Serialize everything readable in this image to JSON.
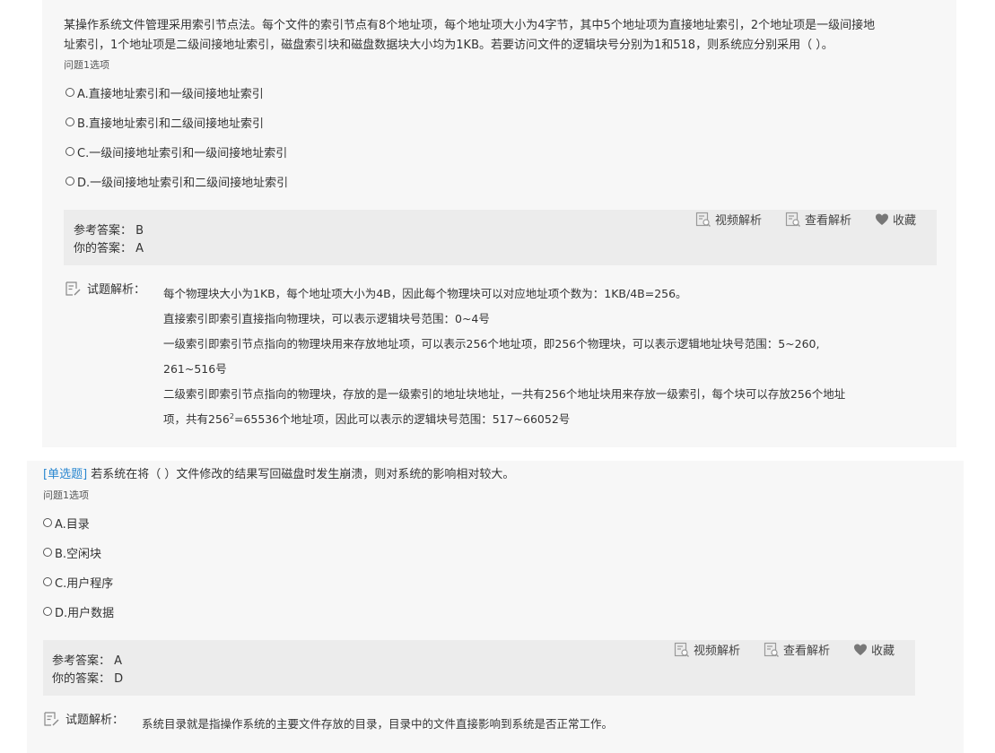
{
  "question1": {
    "text_line1": "某操作系统文件管理采用索引节点法。每个文件的索引节点有8个地址项，每个地址项大小为4字节，其中5个地址项为直接地址索引，2个地址项是一级间接地",
    "text_line2": "址索引，1个地址项是二级间接地址索引，磁盘索引块和磁盘数据块大小均为1KB。若要访问文件的逻辑块号分别为1和518，则系统应分别采用（ ）。",
    "subtitle": "问题1选项",
    "options": [
      {
        "label": "A.直接地址索引和一级间接地址索引"
      },
      {
        "label": "B.直接地址索引和二级间接地址索引"
      },
      {
        "label": "C.一级间接地址索引和一级间接地址索引"
      },
      {
        "label": "D.一级间接地址索引和二级间接地址索引"
      }
    ],
    "reference_answer_label": "参考答案：",
    "reference_answer": "B",
    "your_answer_label": "你的答案：",
    "your_answer": "A",
    "explanation_label": "试题解析：",
    "explanation": {
      "line1": "每个物理块大小为1KB，每个地址项大小为4B，因此每个物理块可以对应地址项个数为：1KB/4B=256。",
      "line2": "直接索引即索引直接指向物理块，可以表示逻辑块号范围：0~4号",
      "line3": "一级索引即索引节点指向的物理块用来存放地址项，可以表示256个地址项，即256个物理块，可以表示逻辑地址块号范围：5~260,",
      "line4": "261~516号",
      "line5": "二级索引即索引节点指向的物理块，存放的是一级索引的地址块地址，一共有256个地址块用来存放一级索引，每个块可以存放256个地址",
      "line6_a": "项，共有256",
      "line6_sup": "2",
      "line6_b": "=65536个地址项，因此可以表示的逻辑块号范围：517~66052号"
    }
  },
  "question2": {
    "type_tag": "[单选题]",
    "text": "若系统在将（ ）文件修改的结果写回磁盘时发生崩溃，则对系统的影响相对较大。",
    "subtitle": "问题1选项",
    "options": [
      {
        "label": "A.目录"
      },
      {
        "label": "B.空闲块"
      },
      {
        "label": "C.用户程序"
      },
      {
        "label": "D.用户数据"
      }
    ],
    "reference_answer_label": "参考答案：",
    "reference_answer": "A",
    "your_answer_label": "你的答案：",
    "your_answer": "D",
    "explanation_label": "试题解析：",
    "explanation": {
      "line1": "系统目录就是指操作系统的主要文件存放的目录，目录中的文件直接影响到系统是否正常工作。"
    }
  },
  "toolbar": {
    "video_label": "视频解析",
    "view_label": "查看解析",
    "favorite_label": "收藏",
    "icons": [
      "video-analysis-icon",
      "view-analysis-icon",
      "heart-icon"
    ]
  }
}
